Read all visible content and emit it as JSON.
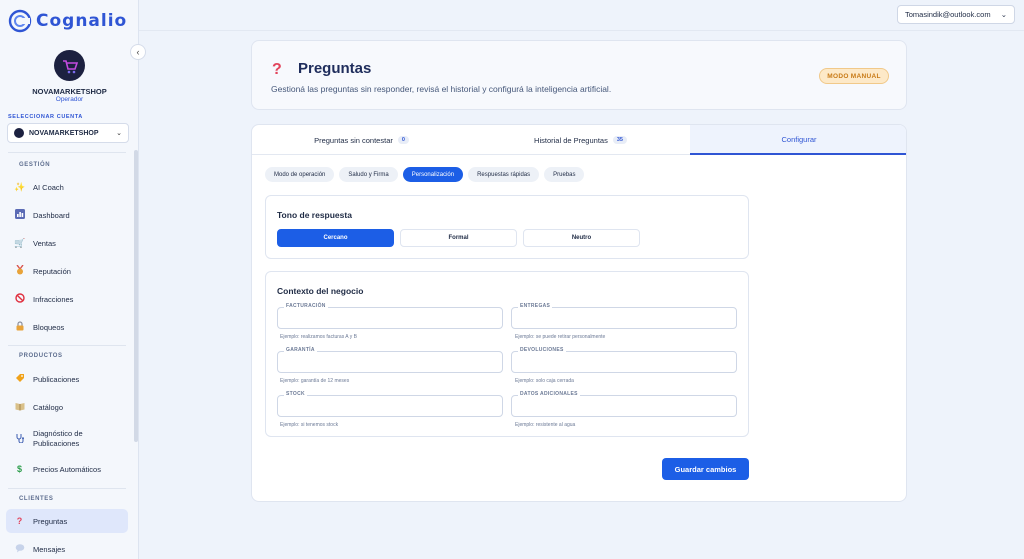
{
  "brand": {
    "name": "Cognalio"
  },
  "account": {
    "name": "NOVAMARKETSHOP",
    "role": "Operador",
    "select_label": "SELECCIONAR CUENTA",
    "selected": "NOVAMARKETSHOP"
  },
  "sections": {
    "gestion": "GESTIÓN",
    "productos": "PRODUCTOS",
    "clientes": "CLIENTES"
  },
  "nav": {
    "ai_coach": "AI Coach",
    "dashboard": "Dashboard",
    "ventas": "Ventas",
    "reputacion": "Reputación",
    "infracciones": "Infracciones",
    "bloqueos": "Bloqueos",
    "publicaciones": "Publicaciones",
    "catalogo": "Catálogo",
    "diagnostico_1": "Diagnóstico de",
    "diagnostico_2": "Publicaciones",
    "precios": "Precios Automáticos",
    "preguntas": "Preguntas",
    "mensajes": "Mensajes"
  },
  "icons": {
    "ai_coach": "sparkles-icon",
    "dashboard": "bar-chart-icon",
    "ventas": "cart-icon",
    "reputacion": "medal-icon",
    "infracciones": "prohibited-icon",
    "bloqueos": "lock-icon",
    "publicaciones": "tag-icon",
    "catalogo": "book-icon",
    "diagnostico": "stethoscope-icon",
    "precios": "dollar-icon",
    "preguntas": "question-icon",
    "mensajes": "chat-bubble-icon"
  },
  "user": {
    "email": "Tomasindik@outlook.com"
  },
  "header": {
    "title": "Preguntas",
    "subtitle": "Gestioná las preguntas sin responder, revisá el historial y configurá la inteligencia artificial.",
    "mode_badge": "MODO MANUAL"
  },
  "tabs": [
    {
      "label": "Preguntas sin contestar",
      "count": "0"
    },
    {
      "label": "Historial de Preguntas",
      "count": "35"
    },
    {
      "label": "Configurar"
    }
  ],
  "subtabs": [
    "Modo de operación",
    "Saludo y Firma",
    "Personalización",
    "Respuestas rápidas",
    "Pruebas"
  ],
  "tone": {
    "title": "Tono de respuesta",
    "options": [
      "Cercano",
      "Formal",
      "Neutro"
    ],
    "selected": "Cercano"
  },
  "context": {
    "title": "Contexto del negocio",
    "fields": [
      {
        "label": "FACTURACIÓN",
        "hint": "Ejemplo: realizamos facturas A y B",
        "value": ""
      },
      {
        "label": "ENTREGAS",
        "hint": "Ejemplo: se puede retirar personalmente",
        "value": ""
      },
      {
        "label": "GARANTÍA",
        "hint": "Ejemplo: garantía de 12 meses",
        "value": ""
      },
      {
        "label": "DEVOLUCIONES",
        "hint": "Ejemplo: solo caja cerrada",
        "value": ""
      },
      {
        "label": "STOCK",
        "hint": "Ejemplo: si tenemos stock",
        "value": ""
      },
      {
        "label": "DATOS ADICIONALES",
        "hint": "Ejemplo: resistente al agua",
        "value": ""
      }
    ]
  },
  "save_label": "Guardar cambios",
  "colors": {
    "primary": "#1c5ee6",
    "brand": "#2f55d4",
    "badge": "#c87a16",
    "question_mark": "#e2455c"
  }
}
